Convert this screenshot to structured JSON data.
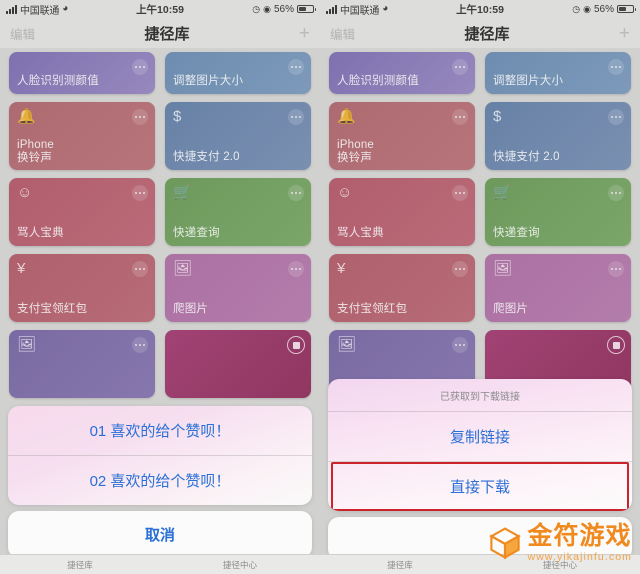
{
  "statusbar": {
    "carrier": "中国联通",
    "wifi_icon": "wifi-icon",
    "time": "上午10:59",
    "alarm_icon": "alarm-icon",
    "rotation_lock_icon": "rotation-lock-icon",
    "battery_percent": "56%",
    "battery_level": 56
  },
  "navbar": {
    "edit_label": "编辑",
    "title": "捷径库",
    "add_label": "+"
  },
  "tiles": [
    {
      "label": "人脸识别测颜值",
      "icon": "",
      "color": "#8071b5",
      "color2": "#9a8bc4",
      "short": true,
      "menu": true
    },
    {
      "label": "调整图片大小",
      "icon": "",
      "color": "#6d8fb5",
      "color2": "#7e9ec1",
      "short": true,
      "menu": true
    },
    {
      "label": "iPhone\n换铃声",
      "icon": "bell-icon",
      "glyph": "🔔",
      "color": "#b46a72",
      "color2": "#bd757c",
      "menu": true
    },
    {
      "label": "快捷支付 2.0",
      "icon": "dollar-icon",
      "glyph": "$",
      "color": "#6783ab",
      "color2": "#7b93b7",
      "menu": true
    },
    {
      "label": "骂人宝典",
      "icon": "smiley-icon",
      "glyph": "☺",
      "color": "#b75c6d",
      "color2": "#c06a79",
      "menu": true
    },
    {
      "label": "快递查询",
      "icon": "cart-icon",
      "glyph": "🛒",
      "color": "#6d9d5b",
      "color2": "#7cab69",
      "menu": true
    },
    {
      "label": "支付宝领红包",
      "icon": "yen-icon",
      "glyph": "¥",
      "color": "#b55f6c",
      "color2": "#bd6c78",
      "menu": true
    },
    {
      "label": "爬图片",
      "icon": "image-icon",
      "glyph": "🖼",
      "color": "#b171a8",
      "color2": "#b97eb0",
      "menu": true
    },
    {
      "label": "",
      "icon": "image-icon",
      "glyph": "🖼",
      "color": "#7b6aa8",
      "color2": "#8878b2",
      "menu": true
    },
    {
      "label": "",
      "icon": "",
      "color": "#a53f75",
      "color2": "#93325f",
      "stop": true
    }
  ],
  "tabbar": {
    "items": [
      {
        "label": "捷径库",
        "name": "tab-library"
      },
      {
        "label": "捷径中心",
        "name": "tab-gallery"
      }
    ]
  },
  "left_sheet": {
    "options": [
      "01 喜欢的给个赞呗！",
      "02 喜欢的给个赞呗！"
    ],
    "cancel_label": "取消"
  },
  "right_sheet": {
    "title": "已获取到下载链接",
    "options": [
      "复制链接",
      "直接下载"
    ],
    "highlighted_option_index": 1,
    "highlight_color": "#cc2229",
    "cancel_label": ""
  },
  "watermark": {
    "brand": "金符游戏",
    "url": "www.yikajinfu.com",
    "icon": "cube-icon",
    "color": "#f08a1e"
  }
}
